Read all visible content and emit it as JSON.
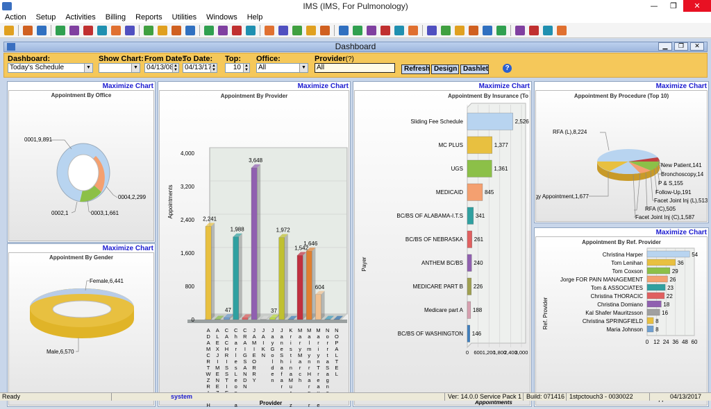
{
  "window": {
    "title": "IMS (IMS, For Pulmonology)"
  },
  "menu": [
    "Action",
    "Setup",
    "Activities",
    "Billing",
    "Reports",
    "Utilities",
    "Windows",
    "Help"
  ],
  "dashboard": {
    "title": "Dashboard"
  },
  "filters": {
    "dashboard_label": "Dashboard:",
    "dashboard_value": "Today's Schedule",
    "show_chart_label": "Show Chart:",
    "show_chart_value": "",
    "from_label": "From Date:",
    "from_value": "04/13/08",
    "to_label": "To Date:",
    "to_value": "04/13/17",
    "top_label": "Top:",
    "top_value": "10",
    "office_label": "Office:",
    "office_value": "All",
    "provider_label": "Provider",
    "provider_hint": "(?)",
    "provider_value": "All",
    "refresh": "Refresh",
    "design": "Design",
    "dashlet": "Dashlet",
    "help": "?"
  },
  "maximize_label": "Maximize  Chart",
  "colors": {
    "accent_bar": "#f5c85a",
    "title_blue": "#1a1ad0"
  },
  "chart_data": [
    {
      "type": "pie",
      "title": "Appointment By Office",
      "labels": [
        "0001,9,891",
        "0004,2,299",
        "0003,1,661",
        "0002,1"
      ],
      "values": [
        9891,
        2299,
        1661,
        1
      ]
    },
    {
      "type": "pie",
      "title": "Appointment By Gender",
      "labels": [
        "Female,6,441",
        "Male,6,570"
      ],
      "values": [
        6441,
        6570
      ]
    },
    {
      "type": "bar",
      "title": "Appointment By Provider",
      "ylabel": "Appointments",
      "xlabel": "Provider",
      "ylim": [
        0,
        4000
      ],
      "yticks": [
        "0",
        "800",
        "1,600",
        "2,400",
        "3,200",
        "4,000"
      ],
      "categories": [
        "ADAMCRTWZRIGHT",
        "ALEXJIMENEZ",
        "CACHRISSTIE",
        "Ch ar le s Le on ha rd",
        "CRAIG SANDN",
        "JAMIE ORRY",
        "JAIKN",
        "Ja y Go ld en",
        "Ja ne Sh af ar",
        "Kri sti na Mu rt zs so n",
        "M ar y M ar ch",
        "M al m y nr Ha rp er",
        "M ar i yn T re a ur e",
        "Nor rta Sa gn ed",
        "NO PAL TE L"
      ],
      "values": [
        2241,
        8,
        47,
        1988,
        44,
        3648,
        7,
        37,
        1972,
        5,
        1542,
        1646,
        604,
        6,
        4
      ],
      "labels": [
        "2,241",
        "",
        "47",
        "1,988",
        "",
        "3,648",
        "",
        "37",
        "1,972",
        "",
        "1,542",
        "1,646",
        "604",
        "",
        ""
      ],
      "labels_full": [
        "2,241",
        "8",
        "47",
        "1,988",
        "44",
        "3,648",
        "7",
        "37",
        "1,972",
        "5",
        "1,542",
        "1,646",
        "604",
        "6",
        "4"
      ]
    },
    {
      "type": "bar",
      "title": "Appointment By Insurance (To",
      "ylabel": "Payer",
      "xlabel": "Appointments",
      "categories": [
        "Sliding Fee Schedule",
        "MC PLUS",
        "UGS",
        "MEDICAID",
        "BC/BS OF ALABAMA-I.T.S",
        "BC/BS OF NEBRASKA",
        "ANTHEM BC/BS",
        "MEDICARE PART B",
        "Medicare part A",
        "BC/BS OF WASHINGTON"
      ],
      "values": [
        2526,
        1377,
        1361,
        845,
        341,
        261,
        240,
        226,
        188,
        146
      ],
      "labels": [
        "2,526",
        "1,377",
        "1,361",
        "845",
        "341",
        "261",
        "240",
        "226",
        "188",
        "146"
      ],
      "xticks": [
        "0",
        "600",
        "1,200",
        "1,800",
        "2,400",
        "3,000"
      ],
      "xlim": [
        0,
        3000
      ]
    },
    {
      "type": "pie",
      "title": "Appointment By Procedure (Top 10)",
      "labels": [
        "RFA (L),8,224",
        "New Patient,141",
        "Bronchoscopy,14",
        "P & S,155",
        "Follow-Up,191",
        "Facet Joint Inj (L),513",
        "RFA (C),505",
        "Facet Joint Inj (C),1,587",
        "gy Appointment,1,677"
      ],
      "values": [
        8224,
        141,
        14,
        155,
        191,
        513,
        505,
        1587,
        1677
      ]
    },
    {
      "type": "bar",
      "title": "Appointment By Ref. Provider",
      "ylabel": "Ref. Provider",
      "xlabel": "Appointments",
      "categories": [
        "Christina Harper",
        "Tom Lenihan",
        "Tom Coxson",
        "Jorge FOR PAIN MANAGEMENT",
        "Tom & ASSOCIATES",
        "Christina THORACIC",
        "Christina Domiano",
        "Kal Shafer Mauritzsson",
        "Christina SPRINGFIELD",
        "Maria Johnson"
      ],
      "values": [
        54,
        36,
        29,
        26,
        23,
        22,
        18,
        16,
        8,
        8
      ],
      "labels": [
        "54",
        "36",
        "29",
        "26",
        "23",
        "22",
        "18",
        "16",
        "8",
        "8"
      ],
      "xticks": [
        "0",
        "12",
        "24",
        "36",
        "48",
        "60"
      ],
      "xlim": [
        0,
        60
      ]
    }
  ],
  "status": {
    "ready": "Ready",
    "user": "system",
    "version": "Ver: 14.0.0 Service Pack 1",
    "build": "Build: 071416",
    "station": "1stpctouch3 - 0030022",
    "date": "04/13/2017"
  }
}
